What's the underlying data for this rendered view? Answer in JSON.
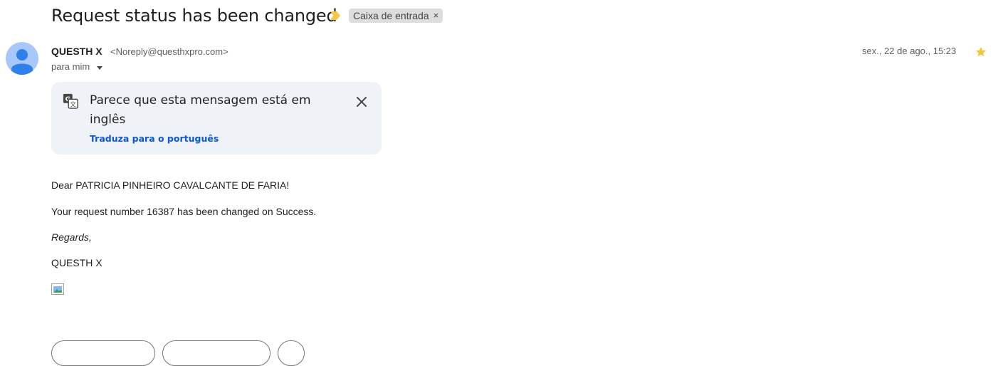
{
  "email": {
    "subject": "Request status has been changed",
    "label": "Caixa de entrada",
    "label_remove": "×",
    "sender_name": "QUESTH X",
    "sender_email": "<Noreply@questhxpro.com>",
    "to_line": "para mim",
    "date": "sex., 22 de ago., 15:23"
  },
  "translate_banner": {
    "message": "Parece que esta mensagem está em inglês",
    "link": "Traduza para o português"
  },
  "body": {
    "greeting": "Dear PATRICIA PINHEIRO CAVALCANTE DE FARIA!",
    "line": "Your request number 16387 has been changed on Success.",
    "regards": "Regards,",
    "signature": "QUESTH X"
  },
  "colors": {
    "accent": "#0b57d0",
    "banner_bg": "#eff2f6",
    "star": "#f4c542",
    "importance": "#f2c94c",
    "avatar": "#a8c7fa"
  },
  "icons": {
    "importance": "importance-marker-icon",
    "star": "star-icon",
    "translate": "translate-icon",
    "close": "close-icon",
    "avatar": "default-avatar-icon",
    "broken_image": "broken-image-icon"
  }
}
